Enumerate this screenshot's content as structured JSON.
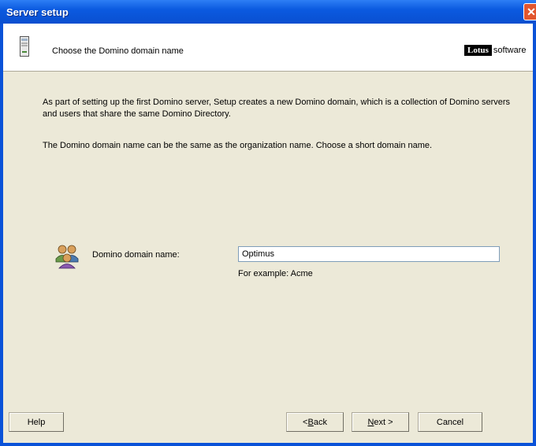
{
  "window": {
    "title": "Server setup"
  },
  "header": {
    "title": "Choose the Domino domain name",
    "logo": {
      "brand": "Lotus",
      "suffix": "software"
    }
  },
  "body": {
    "paragraph1": "As part of setting up the first Domino server, Setup creates a new Domino domain, which is a collection of Domino servers and users that share the same Domino Directory.",
    "paragraph2": "The Domino domain name can be the same as the organization name. Choose a short domain name."
  },
  "form": {
    "domain_label": "Domino domain name:",
    "domain_value": "Optimus",
    "example_text": "For example: Acme"
  },
  "buttons": {
    "help": "Help",
    "back_prefix": "< ",
    "back_key": "B",
    "back_rest": "ack",
    "next_key": "N",
    "next_rest": "ext >",
    "cancel": "Cancel"
  },
  "icons": {
    "server": "server-icon",
    "group": "group-users-icon",
    "close": "close-icon"
  },
  "colors": {
    "titlebar": "#0a52d8",
    "dialog_background": "#ece9d8",
    "header_background": "#ffffff",
    "close_button": "#e2562e"
  }
}
